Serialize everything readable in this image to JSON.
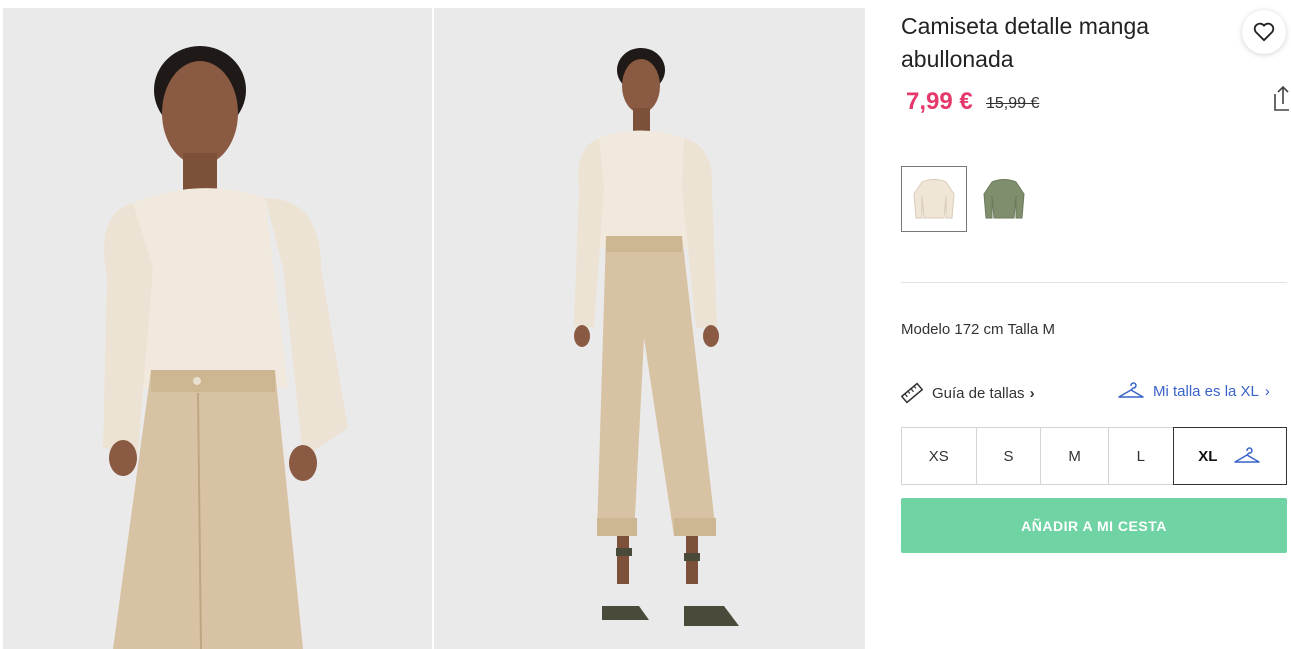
{
  "product": {
    "title": "Camiseta detalle manga abullonada",
    "price_current": "7,99 €",
    "price_old": "15,99 €",
    "model_info": "Modelo 172 cm Talla M"
  },
  "gallery": {
    "top_text": "",
    "images": [
      {
        "semantic": "model-closeup-photo"
      },
      {
        "semantic": "model-fullbody-photo"
      }
    ]
  },
  "icons": {
    "favorite": "heart-icon",
    "share": "share-icon",
    "size_guide": "ruler-icon",
    "my_size": "hanger-icon"
  },
  "colors": {
    "price": "#e5396b",
    "link": "#3a63c9",
    "add_button": "#6fd3a4",
    "swatch_beige": "#efe6d8",
    "swatch_green": "#7f8f6e"
  },
  "swatches": [
    {
      "color_name": "beige",
      "selected": true
    },
    {
      "color_name": "green",
      "selected": false
    }
  ],
  "size_guide": {
    "label": "Guía de tallas",
    "chevron": "›"
  },
  "my_size": {
    "label": "Mi talla es la XL",
    "chevron": "›"
  },
  "sizes": [
    {
      "label": "XS",
      "selected": false
    },
    {
      "label": "S",
      "selected": false
    },
    {
      "label": "M",
      "selected": false
    },
    {
      "label": "L",
      "selected": false
    },
    {
      "label": "XL",
      "selected": true
    }
  ],
  "actions": {
    "add_to_cart": "AÑADIR A MI CESTA"
  }
}
